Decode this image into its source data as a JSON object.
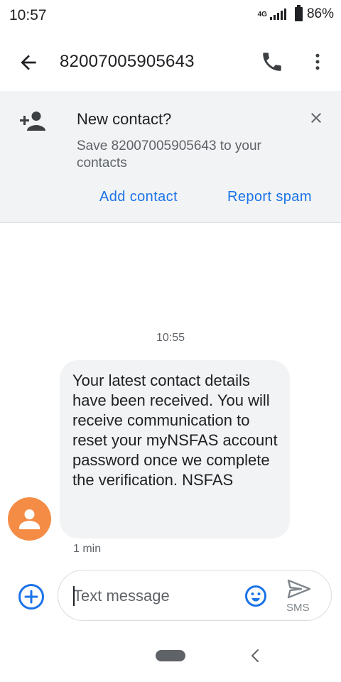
{
  "status_bar": {
    "time": "10:57",
    "network": "4G",
    "battery": "86%",
    "icons": [
      "signal-icon",
      "battery-icon"
    ]
  },
  "app_bar": {
    "title": "82007005905643",
    "icons": [
      "arrow-back-icon",
      "phone-icon",
      "more-vert-icon"
    ]
  },
  "banner": {
    "title": "New contact?",
    "subtitle": "Save 82007005905643 to your contacts",
    "add_contact": "Add contact",
    "report_spam": "Report spam",
    "icons": [
      "person-add-icon",
      "close-icon"
    ]
  },
  "conversation": {
    "timestamp": "10:55",
    "message": {
      "text": "Your latest contact details have been received. You will receive communication to reset your myNSFAS account password once we complete the verification. NSFAS",
      "meta": "1 min",
      "avatar_icon": "person-icon"
    }
  },
  "compose": {
    "placeholder": "Text message",
    "send_label": "SMS",
    "icons": [
      "add-circle-icon",
      "emoji-icon",
      "send-icon"
    ]
  },
  "colors": {
    "accent": "#1a73e8",
    "banner_bg": "#f1f3f4",
    "bubble_bg": "#f1f3f4",
    "avatar": "#f58c45",
    "text_primary": "#202124",
    "text_secondary": "#5f6368"
  }
}
